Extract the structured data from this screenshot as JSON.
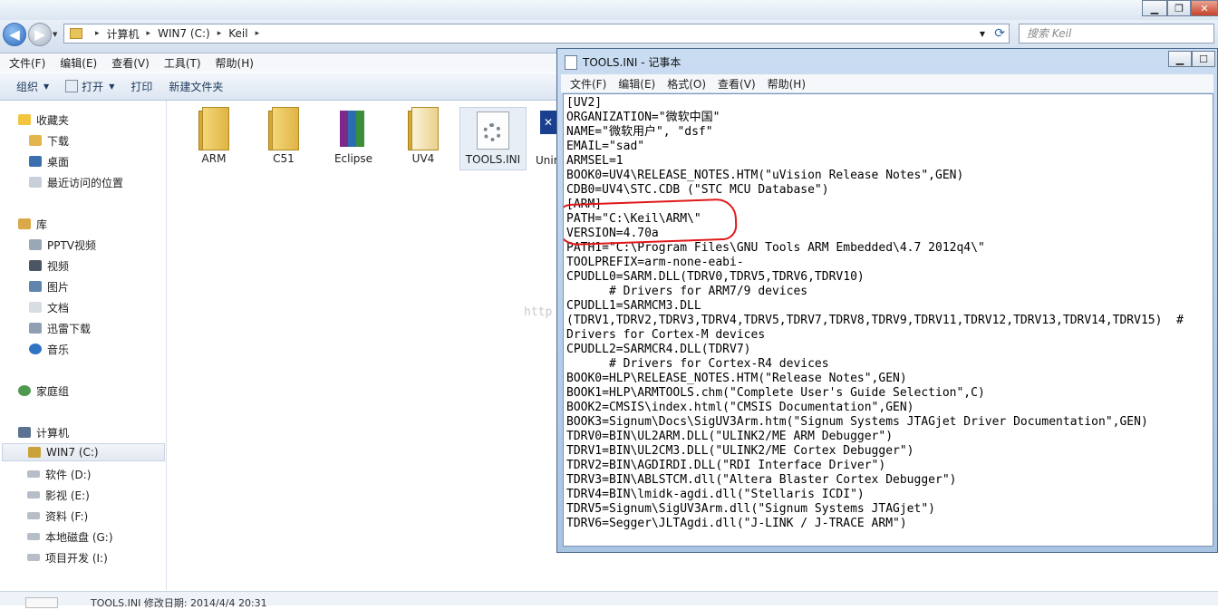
{
  "explorer": {
    "breadcrumb": [
      "计算机",
      "WIN7 (C:)",
      "Keil"
    ],
    "search_placeholder": "搜索 Keil",
    "menu": [
      "文件(F)",
      "编辑(E)",
      "查看(V)",
      "工具(T)",
      "帮助(H)"
    ],
    "toolbar": {
      "organize": "组织",
      "open": "打开",
      "print": "打印",
      "new_folder": "新建文件夹"
    },
    "sidebar": {
      "favorites": "收藏夹",
      "fav_items": [
        "下载",
        "桌面",
        "最近访问的位置"
      ],
      "libraries": "库",
      "lib_items": [
        "PPTV视频",
        "视频",
        "图片",
        "文档",
        "迅雷下载",
        "音乐"
      ],
      "homegroup": "家庭组",
      "computer": "计算机",
      "drives": [
        "WIN7 (C:)",
        "软件 (D:)",
        "影视 (E:)",
        "资料 (F:)",
        "本地磁盘 (G:)",
        "项目开发 (I:)"
      ]
    },
    "files": [
      "ARM",
      "C51",
      "Eclipse",
      "UV4",
      "TOOLS.INI",
      "Unin"
    ],
    "status": "TOOLS.INI  修改日期: 2014/4/4 20:31",
    "watermark": "http"
  },
  "notepad": {
    "title": "TOOLS.INI - 记事本",
    "menu": [
      "文件(F)",
      "编辑(E)",
      "格式(O)",
      "查看(V)",
      "帮助(H)"
    ],
    "content": "[UV2]\nORGANIZATION=\"微软中国\"\nNAME=\"微软用户\", \"dsf\"\nEMAIL=\"sad\"\nARMSEL=1\nBOOK0=UV4\\RELEASE_NOTES.HTM(\"uVision Release Notes\",GEN)\nCDB0=UV4\\STC.CDB (\"STC MCU Database\")\n[ARM]\nPATH=\"C:\\Keil\\ARM\\\"\nVERSION=4.70a\nPATH1=\"C:\\Program Files\\GNU Tools ARM Embedded\\4.7 2012q4\\\"\nTOOLPREFIX=arm-none-eabi-\nCPUDLL0=SARM.DLL(TDRV0,TDRV5,TDRV6,TDRV10)\n      # Drivers for ARM7/9 devices\nCPUDLL1=SARMCM3.DLL\n(TDRV1,TDRV2,TDRV3,TDRV4,TDRV5,TDRV7,TDRV8,TDRV9,TDRV11,TDRV12,TDRV13,TDRV14,TDRV15)  #\nDrivers for Cortex-M devices\nCPUDLL2=SARMCR4.DLL(TDRV7)\n      # Drivers for Cortex-R4 devices\nBOOK0=HLP\\RELEASE_NOTES.HTM(\"Release Notes\",GEN)\nBOOK1=HLP\\ARMTOOLS.chm(\"Complete User's Guide Selection\",C)\nBOOK2=CMSIS\\index.html(\"CMSIS Documentation\",GEN)\nBOOK3=Signum\\Docs\\SigUV3Arm.htm(\"Signum Systems JTAGjet Driver Documentation\",GEN)\nTDRV0=BIN\\UL2ARM.DLL(\"ULINK2/ME ARM Debugger\")\nTDRV1=BIN\\UL2CM3.DLL(\"ULINK2/ME Cortex Debugger\")\nTDRV2=BIN\\AGDIRDI.DLL(\"RDI Interface Driver\")\nTDRV3=BIN\\ABLSTCM.dll(\"Altera Blaster Cortex Debugger\")\nTDRV4=BIN\\lmidk-agdi.dll(\"Stellaris ICDI\")\nTDRV5=Signum\\SigUV3Arm.dll(\"Signum Systems JTAGjet\")\nTDRV6=Segger\\JLTAgdi.dll(\"J-LINK / J-TRACE ARM\")"
  }
}
